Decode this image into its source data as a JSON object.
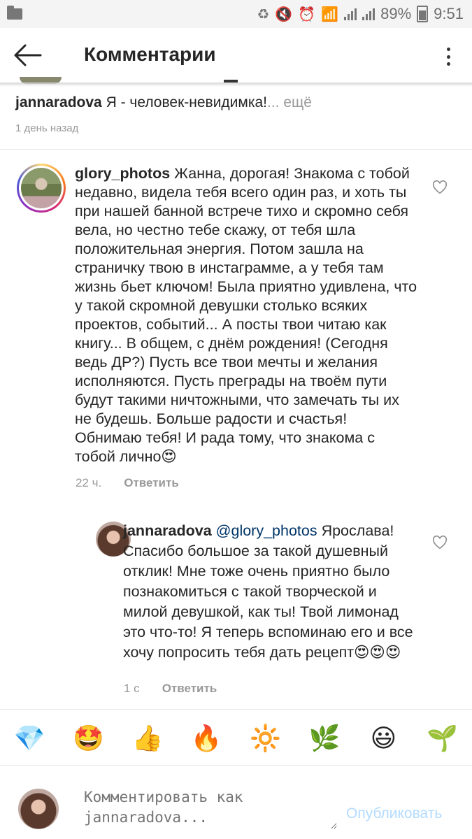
{
  "status_bar": {
    "battery": "89%",
    "time": "9:51"
  },
  "header": {
    "title": "Комментарии"
  },
  "top_comment": {
    "username": "jannaradova",
    "text": "Я - человек-невидимка!",
    "more": "... ещё",
    "time": "1 день назад"
  },
  "main_comment": {
    "username": "glory_photos",
    "text": "Жанна, дорогая! Знакома с тобой недавно, видела тебя всего один раз, и хоть ты при нашей банной встрече тихо и скромно себя вела, но честно тебе скажу, от тебя шла положительная энергия. Потом зашла на страничку твою в инстаграмме, а у тебя там жизнь бьет ключом! Была приятно удивлена, что у такой скромной девушки столько всяких проектов, событий... А посты твои читаю как книгу... В общем, с днём рождения! (Сегодня ведь ДР?) Пусть все твои мечты и желания исполняются. Пусть преграды на твоём пути будут такими ничтожными, что замечать ты их не будешь. Больше радости и счастья! Обнимаю тебя! И рада тому, что знакома с тобой лично😍",
    "time": "22 ч.",
    "reply_label": "Ответить"
  },
  "reply_comment": {
    "username": "jannaradova",
    "mention": "@glory_photos",
    "text": "Ярослава! Спасибо большое за такой душевный отклик! Мне тоже очень приятно было познакомиться с такой творческой и милой девушкой, как ты! Твой лимонад это что-то! Я теперь вспоминаю его и все хочу попросить тебя дать рецепт😍😍😍",
    "time": "1 с",
    "reply_label": "Ответить"
  },
  "emoji_bar": [
    "💎",
    "🤩",
    "👍",
    "🔥",
    "🔆",
    "🌿",
    "😃",
    "🌱"
  ],
  "composer": {
    "placeholder": "Комментировать как jannaradova...",
    "publish_label": "Опубликовать"
  },
  "colors": {
    "link": "#003569",
    "publish_disabled": "#b3dbff",
    "meta_gray": "#999999"
  }
}
